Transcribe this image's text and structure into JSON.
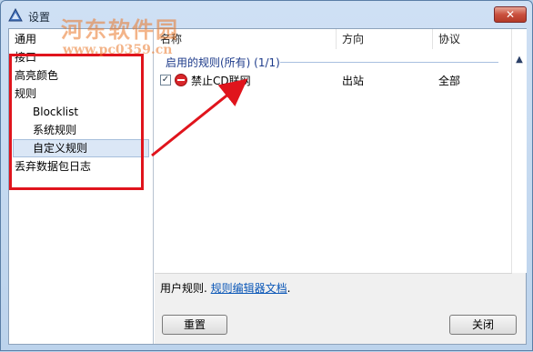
{
  "window": {
    "title": "设置",
    "close_label": "✕",
    "watermark_text": "河东软件园",
    "watermark_url": "www.pc0359.cn"
  },
  "sidebar": {
    "items": [
      {
        "label": "通用"
      },
      {
        "label": "接口"
      },
      {
        "label": "高亮颜色"
      },
      {
        "label": "规则"
      },
      {
        "label": "Blocklist"
      },
      {
        "label": "系统规则"
      },
      {
        "label": "自定义规则"
      },
      {
        "label": "丢弃数据包日志"
      }
    ],
    "selected": "自定义规则"
  },
  "list": {
    "columns": [
      "名称",
      "方向",
      "协议"
    ],
    "group_label": "启用的规则(所有) (1/1)",
    "rows": [
      {
        "checked": "✓",
        "name": "禁止CD联网",
        "direction": "出站",
        "protocol": "全部"
      }
    ]
  },
  "footer": {
    "prefix": "用户规则.",
    "link": "规则编辑器文档",
    "suffix": "."
  },
  "buttons": {
    "reset": "重置",
    "close": "关闭"
  },
  "annotation_color": "#e0141c",
  "icons": [
    "app-icon",
    "close-icon",
    "checkbox-icon",
    "block-icon",
    "collapse-icon"
  ]
}
